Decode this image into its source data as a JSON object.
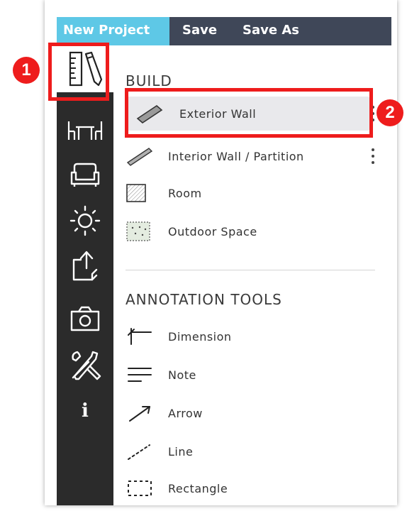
{
  "topbar": {
    "tabs": [
      {
        "label": "New Project"
      },
      {
        "label": "Save"
      },
      {
        "label": "Save As"
      }
    ],
    "active_color": "#5ec8e6",
    "bar_color": "#3f4758"
  },
  "toolbar": {
    "items": [
      {
        "icon": "ruler-pencil-icon",
        "active": true
      },
      {
        "icon": "table-chairs-icon"
      },
      {
        "icon": "sofa-icon"
      },
      {
        "icon": "light-icon"
      },
      {
        "icon": "export-icon"
      },
      {
        "icon": "camera-icon"
      },
      {
        "icon": "tools-icon"
      },
      {
        "icon": "info-icon",
        "text": "i"
      }
    ]
  },
  "build": {
    "title": "BUILD",
    "items": [
      {
        "label": "Exterior Wall",
        "icon": "exterior-wall-icon",
        "selected": true
      },
      {
        "label": "Interior Wall / Partition",
        "icon": "interior-wall-icon"
      },
      {
        "label": "Room",
        "icon": "room-icon"
      },
      {
        "label": "Outdoor Space",
        "icon": "outdoor-space-icon"
      }
    ]
  },
  "annotation_tools": {
    "title": "ANNOTATION TOOLS",
    "items": [
      {
        "label": "Dimension",
        "icon": "dimension-icon"
      },
      {
        "label": "Note",
        "icon": "note-icon"
      },
      {
        "label": "Arrow",
        "icon": "arrow-icon"
      },
      {
        "label": "Line",
        "icon": "line-icon"
      },
      {
        "label": "Rectangle",
        "icon": "rectangle-icon"
      }
    ]
  },
  "annotations": {
    "badge_1": "1",
    "badge_2": "2",
    "highlight_color": "#ee1c1c"
  }
}
